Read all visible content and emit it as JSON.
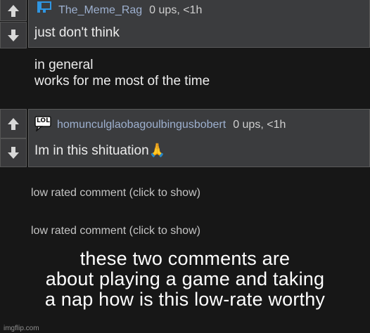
{
  "comments": [
    {
      "username": "The_Meme_Rag",
      "stats": "0 ups, <1h",
      "avatar_icon": "blue-flag-avatar-icon",
      "text": "just don't think\n\nin general\nworks for me most of the time"
    },
    {
      "username": "homunculglaobagoulbingusbobert",
      "stats": "0 ups, <1h",
      "avatar_icon": "lol-speech-bubble-icon",
      "avatar_text": "LOL",
      "text": "Im in this shituation",
      "emoji": "🙏"
    }
  ],
  "low_rated": [
    "low rated comment (click to show)",
    "low rated comment (click to show)"
  ],
  "caption": {
    "line1": "these two comments are",
    "line2": "about playing a game and taking",
    "line3": "a nap how is this low-rate worthy"
  },
  "watermark": "imgflip.com",
  "icons": {
    "upvote": "up-arrow-icon",
    "downvote": "down-arrow-icon"
  },
  "colors": {
    "background": "#171717",
    "comment_bg": "#3b3c3e",
    "username": "#9db0cf",
    "avatar_blue": "#2f96e2"
  }
}
